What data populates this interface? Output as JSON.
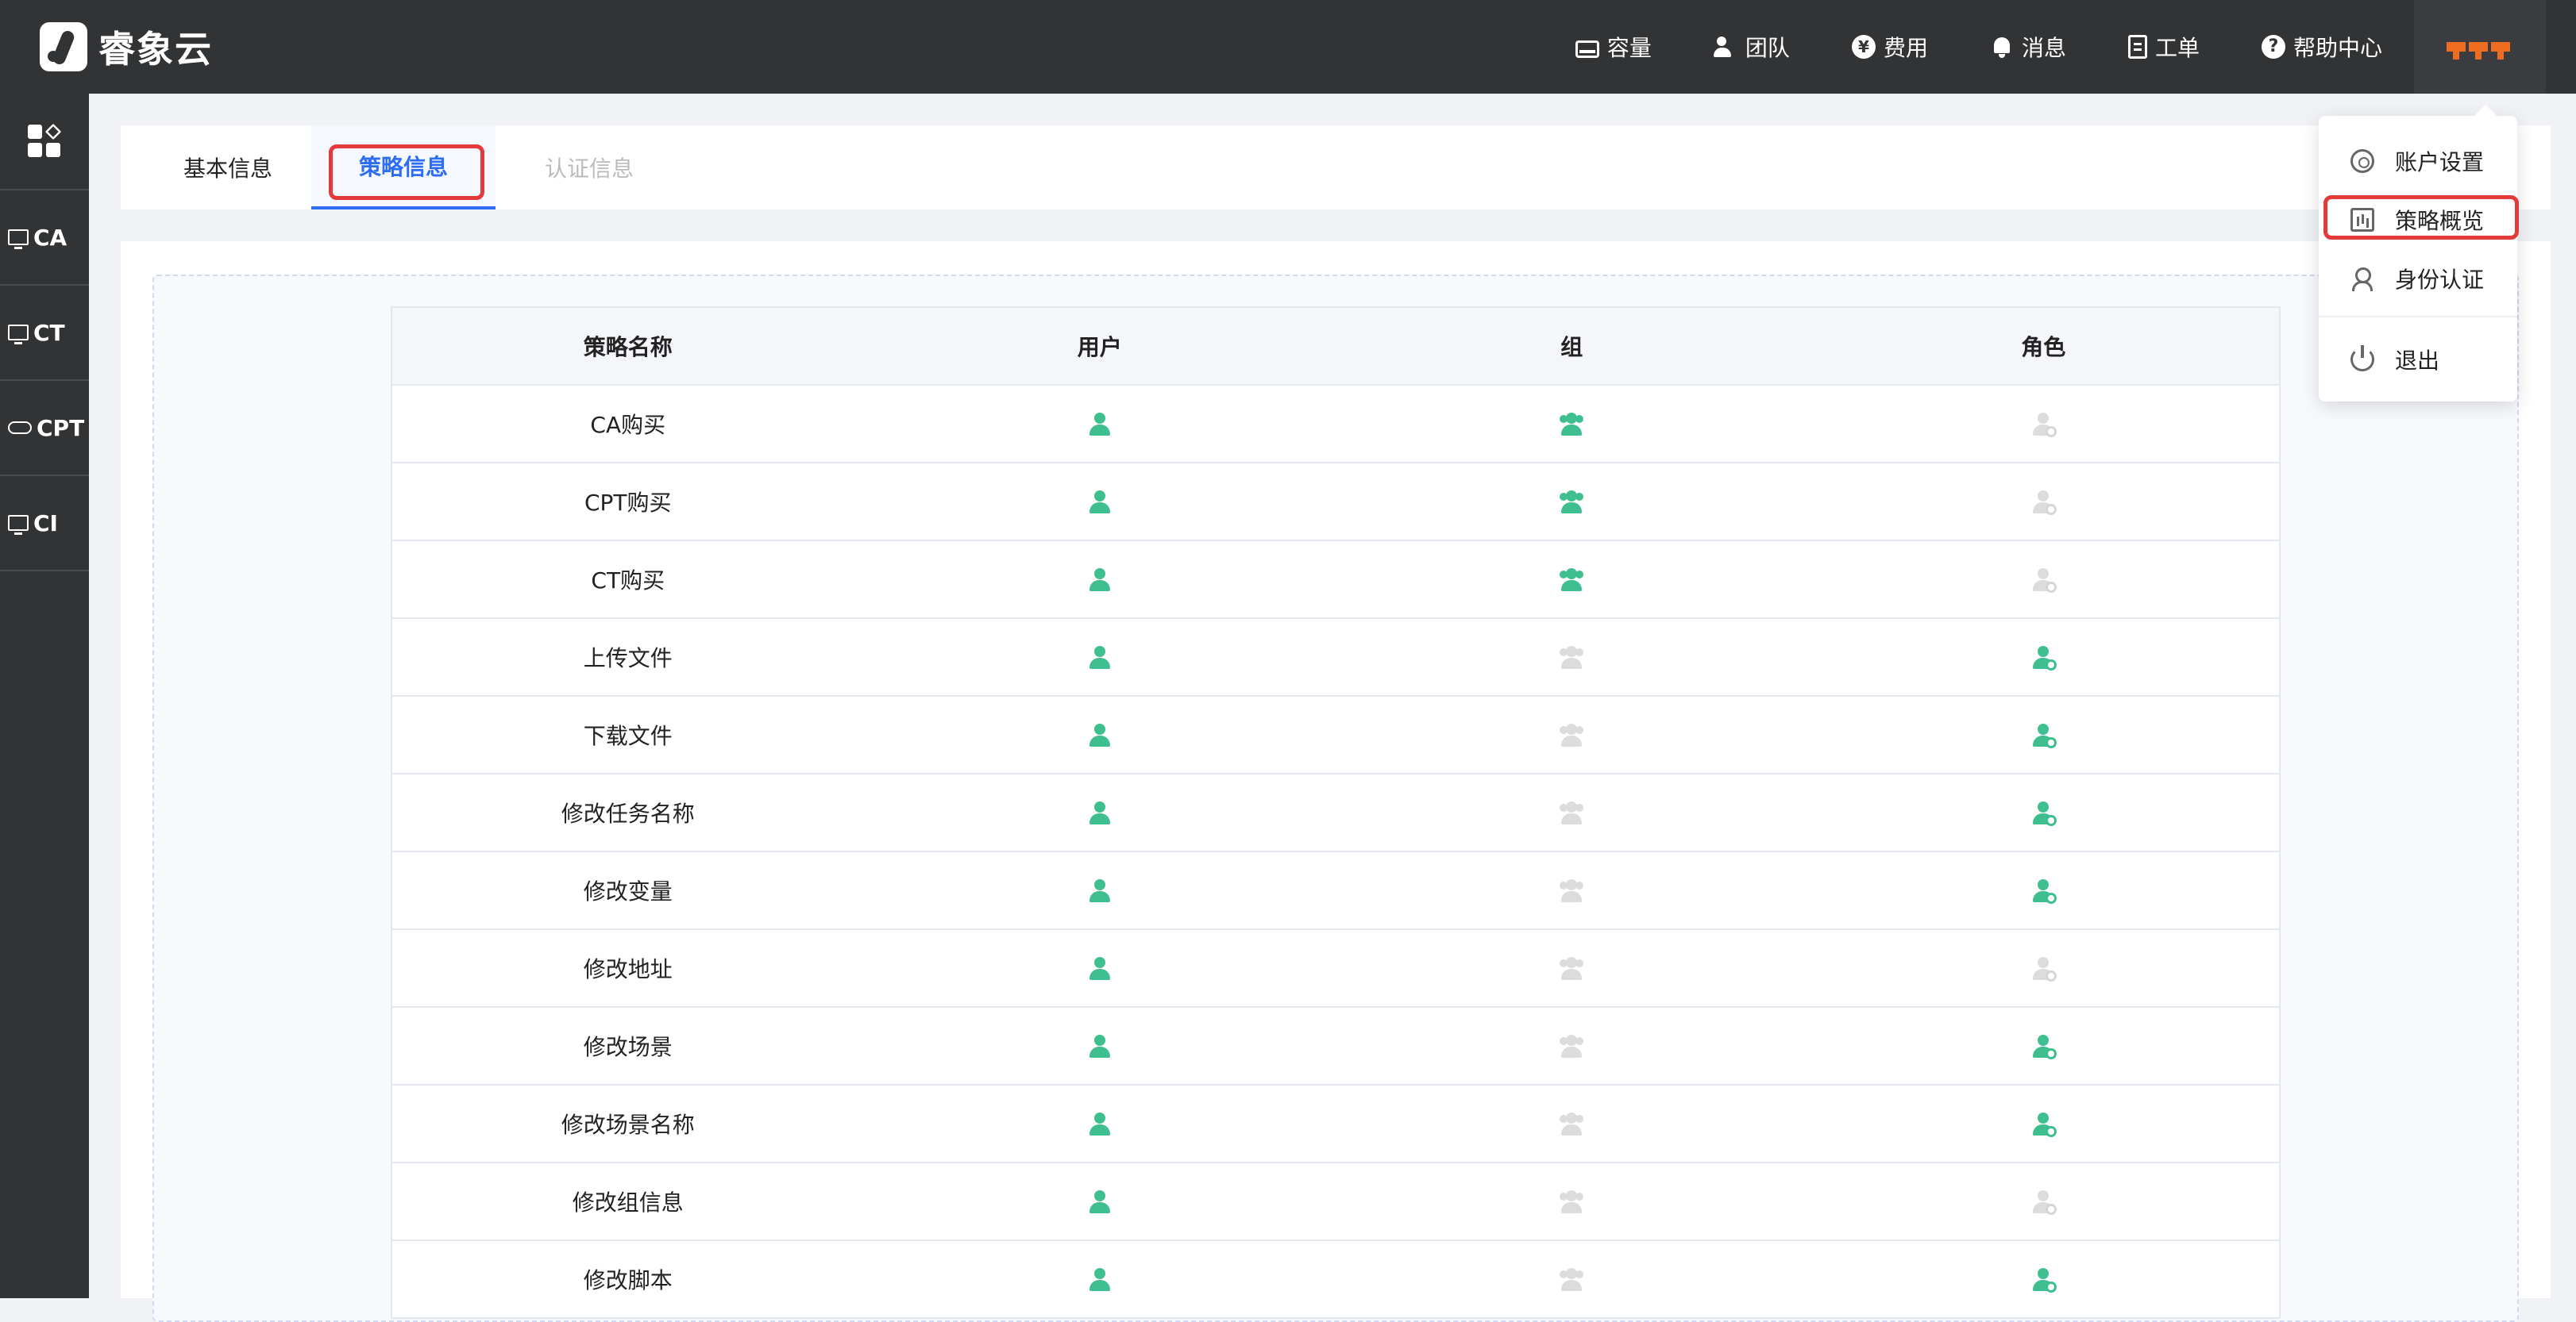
{
  "brand": {
    "name": "睿象云"
  },
  "topnav": [
    {
      "id": "capacity",
      "label": "容量",
      "icon": "capacity-icon"
    },
    {
      "id": "team",
      "label": "团队",
      "icon": "team-icon"
    },
    {
      "id": "fee",
      "label": "费用",
      "icon": "yen-icon",
      "glyph": "¥"
    },
    {
      "id": "message",
      "label": "消息",
      "icon": "bell-icon"
    },
    {
      "id": "ticket",
      "label": "工单",
      "icon": "clipboard-icon"
    },
    {
      "id": "help",
      "label": "帮助中心",
      "icon": "help-icon",
      "glyph": "?"
    }
  ],
  "sidebar": {
    "items": [
      {
        "label": "CA",
        "icon": "monitor-icon"
      },
      {
        "label": "CT",
        "icon": "monitor-icon"
      },
      {
        "label": "CPT",
        "icon": "cloud-icon"
      },
      {
        "label": "CI",
        "icon": "monitor-icon"
      }
    ]
  },
  "tabs": [
    {
      "label": "基本信息",
      "state": "normal"
    },
    {
      "label": "策略信息",
      "state": "active"
    },
    {
      "label": "认证信息",
      "state": "disabled"
    }
  ],
  "table": {
    "headers": [
      "策略名称",
      "用户",
      "组",
      "角色"
    ],
    "rows": [
      {
        "name": "CA购买",
        "user": true,
        "group": true,
        "role": false
      },
      {
        "name": "CPT购买",
        "user": true,
        "group": true,
        "role": false
      },
      {
        "name": "CT购买",
        "user": true,
        "group": true,
        "role": false
      },
      {
        "name": "上传文件",
        "user": true,
        "group": false,
        "role": true
      },
      {
        "name": "下载文件",
        "user": true,
        "group": false,
        "role": true
      },
      {
        "name": "修改任务名称",
        "user": true,
        "group": false,
        "role": true
      },
      {
        "name": "修改变量",
        "user": true,
        "group": false,
        "role": true
      },
      {
        "name": "修改地址",
        "user": true,
        "group": false,
        "role": false
      },
      {
        "name": "修改场景",
        "user": true,
        "group": false,
        "role": true
      },
      {
        "name": "修改场景名称",
        "user": true,
        "group": false,
        "role": true
      },
      {
        "name": "修改组信息",
        "user": true,
        "group": false,
        "role": false
      },
      {
        "name": "修改脚本",
        "user": true,
        "group": false,
        "role": true
      }
    ]
  },
  "dropdown": {
    "items": [
      {
        "label": "账户设置",
        "icon": "gear-icon"
      },
      {
        "label": "策略概览",
        "icon": "chart-icon"
      },
      {
        "label": "身份认证",
        "icon": "person-icon"
      },
      {
        "label": "退出",
        "icon": "power-icon"
      }
    ]
  },
  "colors": {
    "accent": "#2d6df6",
    "enabled": "#3fbf8f",
    "disabled": "#dcdcdc",
    "highlight": "#e33a3a",
    "topbar": "#323335"
  }
}
